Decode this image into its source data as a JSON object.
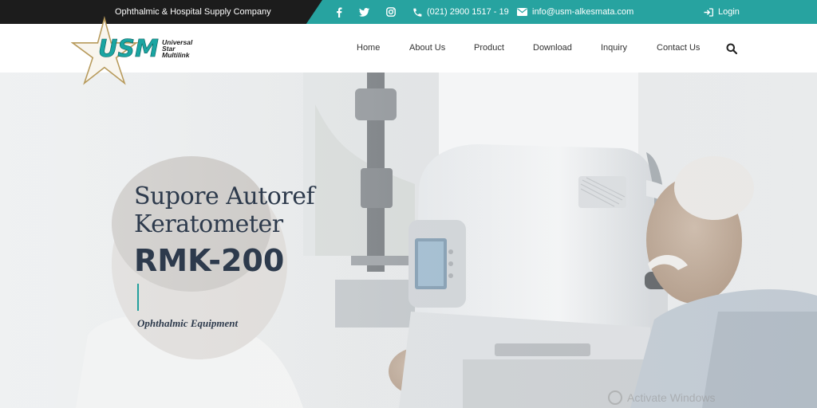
{
  "topbar": {
    "tagline": "Ophthalmic & Hospital Supply Company",
    "social": [
      {
        "icon": "facebook-icon"
      },
      {
        "icon": "twitter-icon"
      },
      {
        "icon": "instagram-icon"
      }
    ],
    "phone": "(021) 2900 1517 - 19",
    "email": "info@usm-alkesmata.com",
    "login": "Login",
    "colors": {
      "dark": "#1c1c1c",
      "accent": "#27a3a0"
    }
  },
  "logo": {
    "mark": "USM",
    "line1": "Universal",
    "line2": "Star",
    "line3": "Multilink"
  },
  "nav": {
    "items": [
      "Home",
      "About Us",
      "Product",
      "Download",
      "Inquiry",
      "Contact Us"
    ],
    "search_icon": "search-icon"
  },
  "hero": {
    "title_line1": "Supore Autoref",
    "title_line2": "Keratometer",
    "model": "RMK-200",
    "subtitle": "Ophthalmic Equipment",
    "watermark": "Activate Windows"
  }
}
